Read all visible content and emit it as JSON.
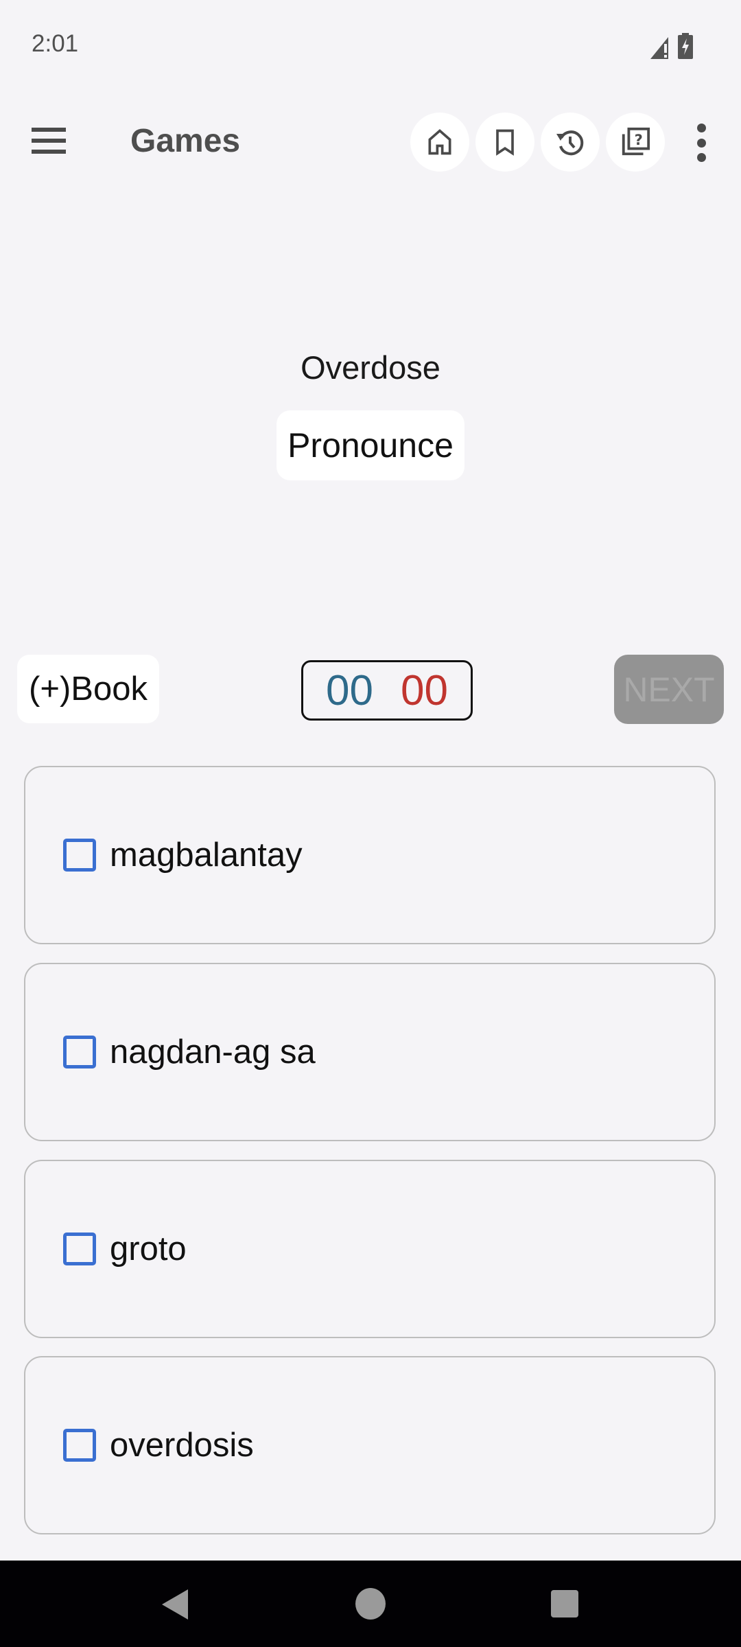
{
  "status_bar": {
    "time": "2:01",
    "icons": [
      "signal-icon",
      "battery-charging-icon"
    ]
  },
  "toolbar": {
    "title": "Games",
    "menu_icon": "hamburger-menu-icon",
    "actions": [
      {
        "name": "home",
        "icon": "home-icon"
      },
      {
        "name": "bookmarks",
        "icon": "bookmark-icon"
      },
      {
        "name": "history",
        "icon": "history-icon"
      },
      {
        "name": "quiz",
        "icon": "quiz-icon"
      }
    ],
    "more_icon": "more-vert-icon"
  },
  "question": {
    "word": "Overdose",
    "pronounce_label": "Pronounce"
  },
  "controls": {
    "book_label": "(+)Book",
    "correct_count": "00",
    "wrong_count": "00",
    "next_label": "NEXT"
  },
  "colors": {
    "correct": "#2e6a8a",
    "wrong": "#c0352f",
    "checkbox": "#3a6fd1"
  },
  "options": [
    {
      "label": "magbalantay",
      "checked": false
    },
    {
      "label": "nagdan-ag sa",
      "checked": false
    },
    {
      "label": "groto",
      "checked": false
    },
    {
      "label": "overdosis",
      "checked": false
    }
  ],
  "nav_bar": {
    "back_icon": "back-icon",
    "home_icon": "home-circle-icon",
    "recents_icon": "recents-icon"
  }
}
